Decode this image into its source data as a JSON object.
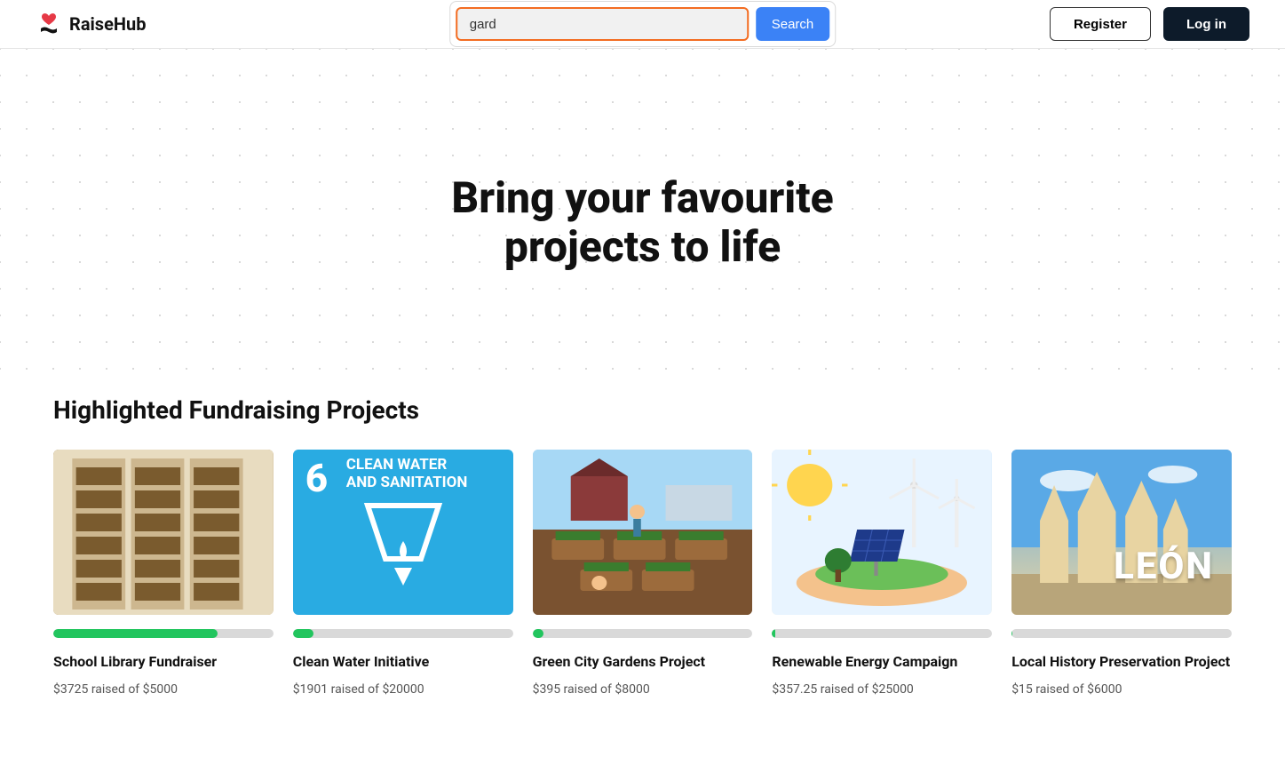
{
  "brand": {
    "name": "RaiseHub"
  },
  "search": {
    "value": "gard",
    "button": "Search"
  },
  "auth": {
    "register": "Register",
    "login": "Log in"
  },
  "hero": {
    "title": "Bring your favourite\nprojects to life"
  },
  "section": {
    "title": "Highlighted Fundraising Projects"
  },
  "projects": [
    {
      "title": "School Library Fundraiser",
      "raised": 3725,
      "goal": 5000,
      "raised_text": "$3725 raised of $5000",
      "progress_pct": 74.5
    },
    {
      "title": "Clean Water Initiative",
      "raised": 1901,
      "goal": 20000,
      "raised_text": "$1901 raised of $20000",
      "progress_pct": 9.5,
      "thumb_big": "6",
      "thumb_label": "CLEAN WATER\nAND SANITATION"
    },
    {
      "title": "Green City Gardens Project",
      "raised": 395,
      "goal": 8000,
      "raised_text": "$395 raised of $8000",
      "progress_pct": 4.94
    },
    {
      "title": "Renewable Energy Campaign",
      "raised": 357.25,
      "goal": 25000,
      "raised_text": "$357.25 raised of $25000",
      "progress_pct": 1.43
    },
    {
      "title": "Local History Preservation Project",
      "raised": 15,
      "goal": 6000,
      "raised_text": "$15 raised of $6000",
      "progress_pct": 0.25,
      "thumb_text": "LEÓN"
    }
  ]
}
